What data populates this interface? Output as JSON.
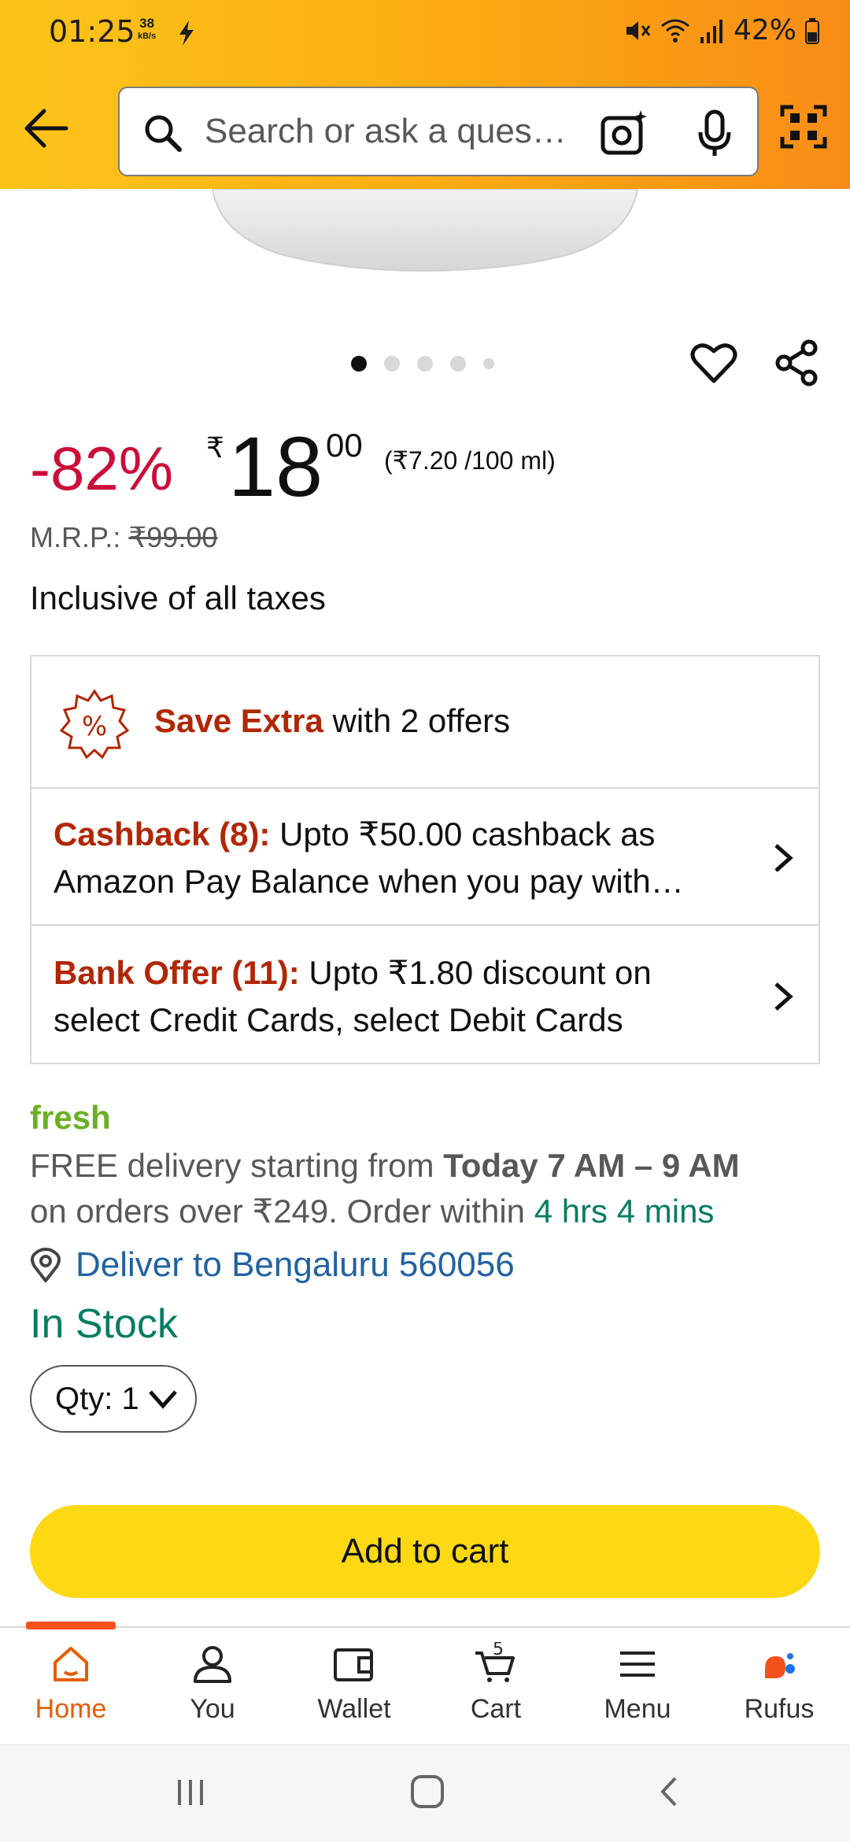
{
  "status_bar": {
    "time": "01:25",
    "net_speed_value": "38",
    "net_speed_unit": "kB/s",
    "battery": "42%"
  },
  "header": {
    "search_placeholder": "Search or ask a ques…",
    "icons": [
      "back-arrow-icon",
      "search-icon",
      "camera-icon",
      "mic-icon",
      "qr-scan-icon"
    ]
  },
  "gallery": {
    "total_images": 5,
    "active_index": 0
  },
  "price": {
    "discount": "-82%",
    "currency": "₹",
    "whole": "18",
    "fraction": "00",
    "unit_price": "(₹7.20 /100 ml)",
    "mrp_label": "M.R.P.:",
    "mrp_value": "₹99.00",
    "taxes": "Inclusive of all taxes"
  },
  "offers": {
    "header_accent": "Save Extra",
    "header_rest": " with 2 offers",
    "items": [
      {
        "title": "Cashback (8):",
        "line1": " Upto ₹50.00 cashback as",
        "line2": "Amazon Pay Balance when you pay with…"
      },
      {
        "title": "Bank Offer (11):",
        "line1": " Upto ₹1.80 discount on",
        "line2": "select Credit Cards, select Debit Cards"
      }
    ]
  },
  "delivery": {
    "brand": "fresh",
    "text1": "FREE delivery starting from ",
    "window": "Today 7 AM – 9 AM",
    "text2": "on orders over ₹249. Order within ",
    "countdown": "4 hrs 4 mins",
    "deliver_to": "Deliver to Bengaluru 560056",
    "stock": "In Stock",
    "qty": "Qty: 1"
  },
  "actions": {
    "add_to_cart": "Add to cart"
  },
  "bottom_nav": {
    "items": [
      {
        "label": "Home",
        "icon": "home-icon"
      },
      {
        "label": "You",
        "icon": "user-icon"
      },
      {
        "label": "Wallet",
        "icon": "wallet-icon"
      },
      {
        "label": "Cart",
        "icon": "cart-icon",
        "badge": "5"
      },
      {
        "label": "Menu",
        "icon": "menu-icon"
      },
      {
        "label": "Rufus",
        "icon": "rufus-icon"
      }
    ]
  },
  "colors": {
    "header_start": "#fcc419",
    "header_end": "#f98c16",
    "discount": "#cc0c39",
    "offer_accent": "#b12704",
    "fresh_green": "#6ab023",
    "stock_green": "#067d62",
    "link_blue": "#2162a1",
    "cart_button": "#ffd814",
    "nav_active": "#e65c00"
  }
}
